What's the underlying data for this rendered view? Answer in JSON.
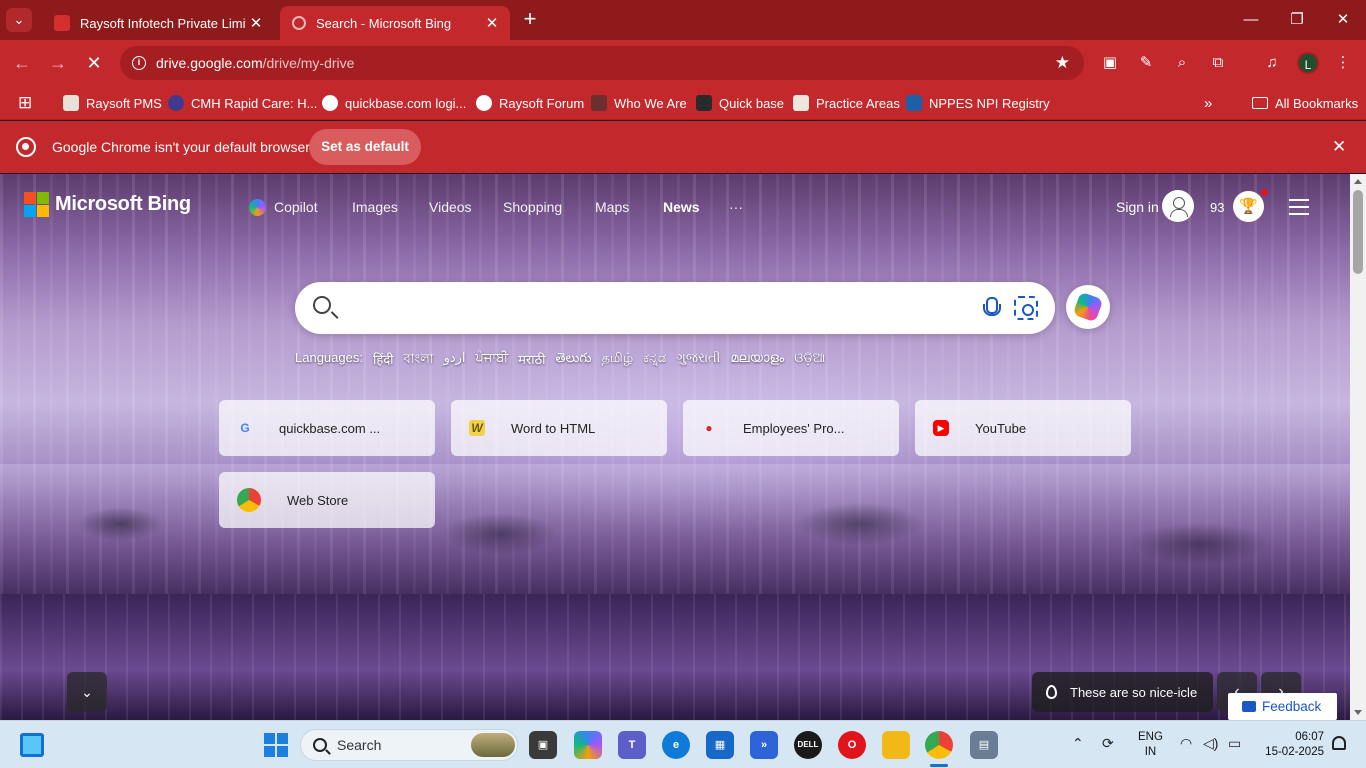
{
  "browser": {
    "tabs": [
      {
        "title": "Raysoft Infotech Private Limited",
        "favicon_color": "#d32f2f",
        "active": false
      },
      {
        "title": "Search - Microsoft Bing",
        "favicon_color": "#f5b6b6",
        "active": true
      }
    ],
    "url_host": "drive.google.com",
    "url_path": "/drive/my-drive",
    "profile_initial": "L",
    "bookmarks": [
      {
        "label": "Raysoft PMS",
        "color": "#e9e1d6"
      },
      {
        "label": "CMH Rapid Care: H...",
        "color": "#3d3a8f"
      },
      {
        "label": "quickbase.com logi...",
        "color": "#ffffff"
      },
      {
        "label": "Raysoft Forum",
        "color": "#ffffff"
      },
      {
        "label": "Who We Are",
        "color": "#6b2f2f"
      },
      {
        "label": "Quick base",
        "color": "#2a2a2a"
      },
      {
        "label": "Practice Areas",
        "color": "#efe7dd"
      },
      {
        "label": "NPPES NPI Registry",
        "color": "#1f5fa8"
      }
    ],
    "all_bookmarks_label": "All Bookmarks",
    "infobar_message": "Google Chrome isn't your default browser",
    "infobar_button": "Set as default"
  },
  "bing": {
    "logo_text": "Microsoft Bing",
    "logo_colors": [
      "#f25022",
      "#7fba00",
      "#00a4ef",
      "#ffb900"
    ],
    "nav": [
      {
        "label": "Copilot"
      },
      {
        "label": "Images"
      },
      {
        "label": "Videos"
      },
      {
        "label": "Shopping"
      },
      {
        "label": "Maps"
      },
      {
        "label": "News"
      },
      {
        "label": "···"
      }
    ],
    "sign_in": "Sign in",
    "points": "93",
    "search_value": "",
    "languages_label": "Languages:",
    "languages": [
      "हिंदी",
      "বাংলা",
      "اردو",
      "ਪੰਜਾਬੀ",
      "मराठी",
      "తెలుగు",
      "தமிழ்",
      "ಕನ್ನಡ",
      "ગુજરાતી",
      "മലയാളം",
      "ଓଡ଼ିଆ"
    ],
    "tiles": [
      {
        "label": "quickbase.com ...",
        "icon_text": "G",
        "icon_color": "#4285f4",
        "icon_bg": "transparent"
      },
      {
        "label": "Word to HTML",
        "icon_text": "W",
        "icon_color": "#6b5a00",
        "icon_bg": "#f2d24a"
      },
      {
        "label": "Employees' Pro...",
        "icon_text": "●",
        "icon_color": "#d62c2c",
        "icon_bg": "transparent"
      },
      {
        "label": "YouTube",
        "icon_text": "▶",
        "icon_color": "#ffffff",
        "icon_bg": "#ff0000"
      },
      {
        "label": "Web Store",
        "icon_text": "◉",
        "icon_color": "#34a853",
        "icon_bg": "transparent"
      }
    ],
    "image_caption": "These are so nice-icle",
    "feedback_label": "Feedback"
  },
  "taskbar": {
    "search_placeholder": "Search",
    "language_line1": "ENG",
    "language_line2": "IN",
    "time": "06:07",
    "date": "15-02-2025"
  }
}
